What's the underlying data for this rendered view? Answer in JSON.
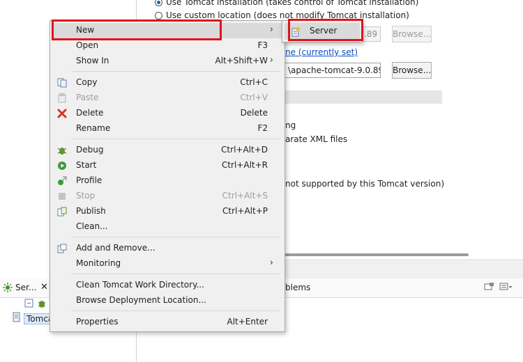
{
  "editor": {
    "radio_tomcat_install": "Use Tomcat installation (takes control of Tomcat installation)",
    "radio_custom_location": "Use custom location (does not modify Tomcat installation)",
    "server_path_value": ".89",
    "browse_label": "Browse...",
    "link_text": "ne (currently set)",
    "deploy_path_value": "\\apache-tomcat-9.0.89\\",
    "browse2_label": "Browse...",
    "option_text_1": "ng",
    "option_text_2": "arate XML files",
    "note_text": "not supported by this Tomcat version)",
    "problems_tab": "blems"
  },
  "servers_view": {
    "tab_label": "Ser...",
    "server_item": "Tomca"
  },
  "context_menu": {
    "items": [
      {
        "label": "New",
        "accel": "",
        "submenu": true,
        "icon": ""
      },
      {
        "label": "Open",
        "accel": "F3",
        "icon": ""
      },
      {
        "label": "Show In",
        "accel": "Alt+Shift+W",
        "submenu": true,
        "icon": ""
      },
      {
        "label": "Copy",
        "accel": "Ctrl+C",
        "icon": "copy-icon"
      },
      {
        "label": "Paste",
        "accel": "Ctrl+V",
        "icon": "paste-icon",
        "disabled": true
      },
      {
        "label": "Delete",
        "accel": "Delete",
        "icon": "delete-icon"
      },
      {
        "label": "Rename",
        "accel": "F2",
        "icon": ""
      },
      {
        "label": "Debug",
        "accel": "Ctrl+Alt+D",
        "icon": "debug-icon"
      },
      {
        "label": "Start",
        "accel": "Ctrl+Alt+R",
        "icon": "start-icon"
      },
      {
        "label": "Profile",
        "accel": "",
        "icon": "profile-icon"
      },
      {
        "label": "Stop",
        "accel": "Ctrl+Alt+S",
        "icon": "stop-icon",
        "disabled": true
      },
      {
        "label": "Publish",
        "accel": "Ctrl+Alt+P",
        "icon": "publish-icon"
      },
      {
        "label": "Clean...",
        "accel": "",
        "icon": ""
      },
      {
        "label": "Add and Remove...",
        "accel": "",
        "icon": "add-remove-icon"
      },
      {
        "label": "Monitoring",
        "accel": "",
        "submenu": true,
        "icon": ""
      },
      {
        "label": "Clean Tomcat Work Directory...",
        "accel": "",
        "icon": ""
      },
      {
        "label": "Browse Deployment Location...",
        "accel": "",
        "icon": ""
      },
      {
        "label": "Properties",
        "accel": "Alt+Enter",
        "icon": ""
      }
    ]
  },
  "submenu": {
    "server_label": "Server"
  },
  "colors": {
    "highlight_box": "#e0141b",
    "menu_bg": "#f0f0f0",
    "link": "#0a4fc4"
  }
}
